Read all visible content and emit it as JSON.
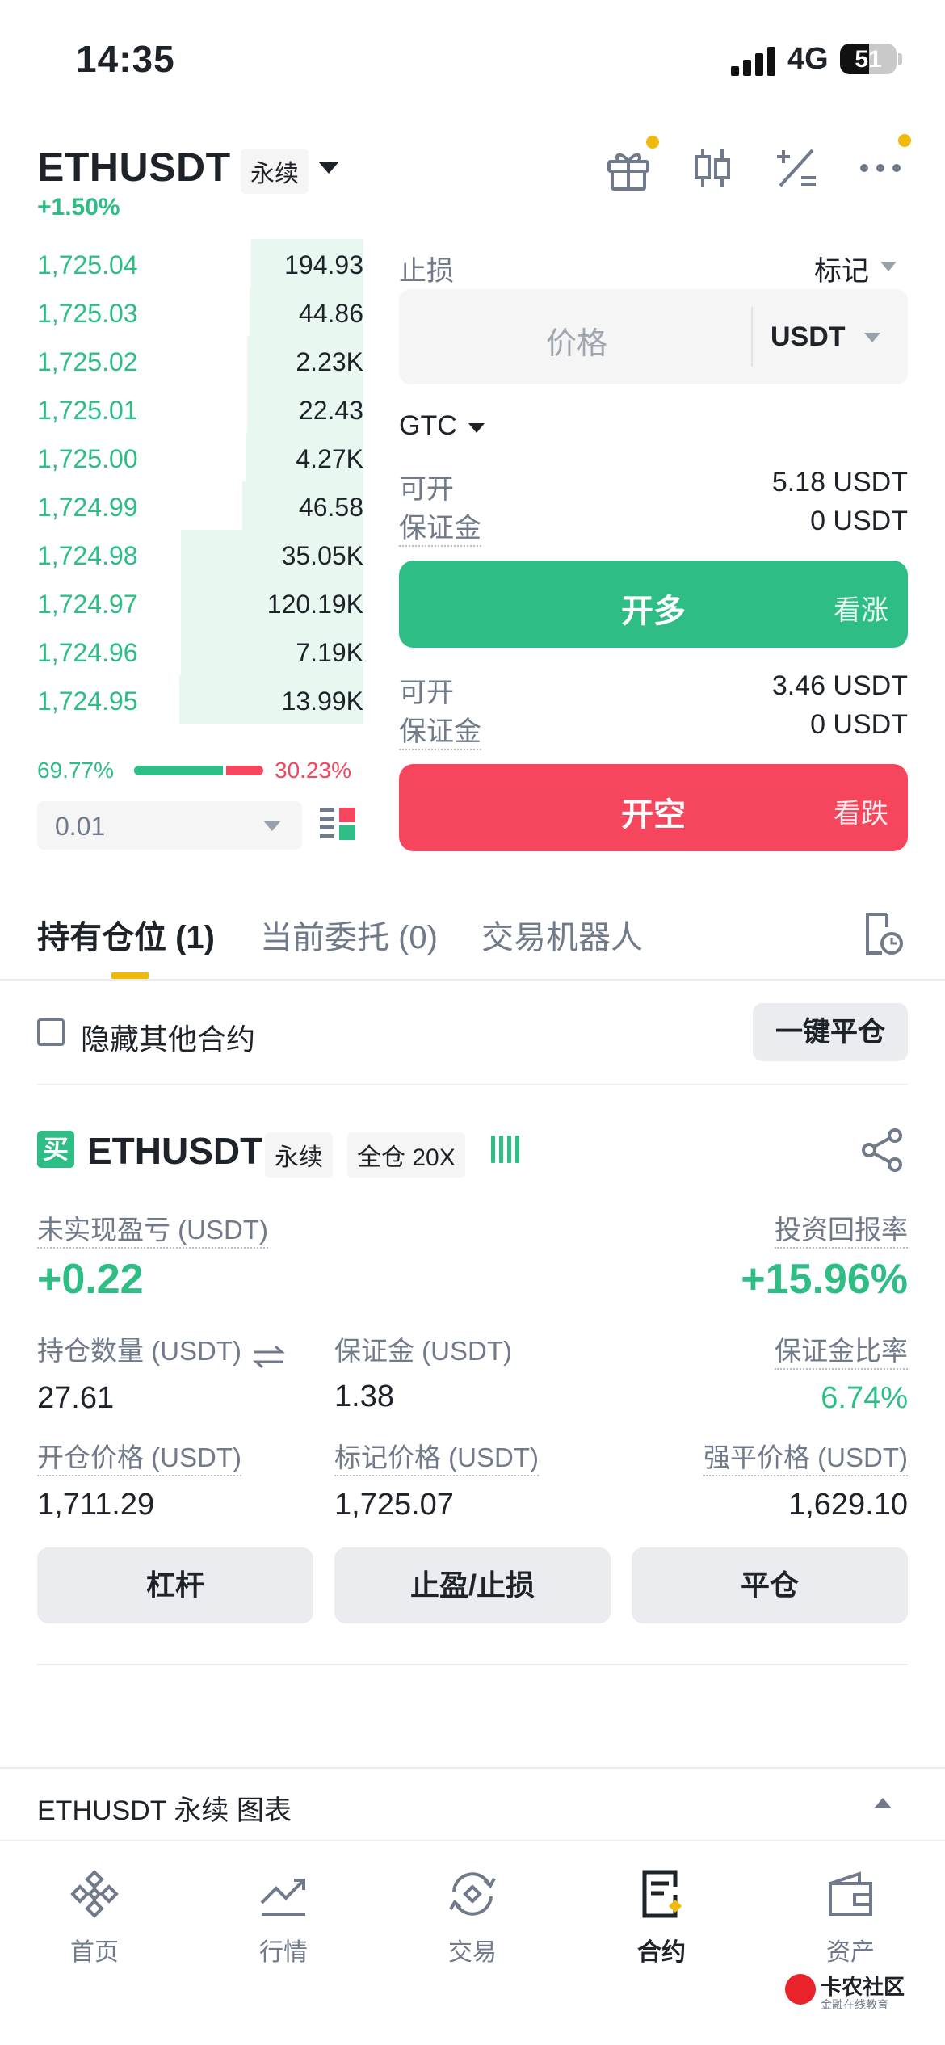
{
  "status_bar": {
    "time": "14:35",
    "network": "4G",
    "battery": "51",
    "battery_level": 0.51
  },
  "header": {
    "symbol": "ETHUSDT",
    "type_tag": "永续",
    "change": "+1.50%",
    "icons": [
      "gift-icon",
      "candlestick-icon",
      "calculator-icon",
      "more-icon"
    ]
  },
  "orderbook": {
    "rows": [
      {
        "price": "1,725.04",
        "qty": "194.93",
        "depth": 0.61
      },
      {
        "price": "1,725.03",
        "qty": "44.86",
        "depth": 0.62
      },
      {
        "price": "1,725.02",
        "qty": "2.23K",
        "depth": 0.63
      },
      {
        "price": "1,725.01",
        "qty": "22.43",
        "depth": 0.63
      },
      {
        "price": "1,725.00",
        "qty": "4.27K",
        "depth": 0.64
      },
      {
        "price": "1,724.99",
        "qty": "46.58",
        "depth": 0.66
      },
      {
        "price": "1,724.98",
        "qty": "35.05K",
        "depth": 0.99
      },
      {
        "price": "1,724.97",
        "qty": "120.19K",
        "depth": 0.99
      },
      {
        "price": "1,724.96",
        "qty": "7.19K",
        "depth": 0.99
      },
      {
        "price": "1,724.95",
        "qty": "13.99K",
        "depth": 1.0
      }
    ],
    "buy_ratio": "69.77%",
    "sell_ratio": "30.23%",
    "buy_ratio_value": 0.6977,
    "precision": "0.01"
  },
  "form": {
    "order_type": "止损",
    "trigger_type": "标记",
    "price_placeholder": "价格",
    "price_unit": "USDT",
    "time_in_force": "GTC",
    "long": {
      "avail_label": "可开",
      "avail_value": "5.18 USDT",
      "margin_label": "保证金",
      "margin_value": "0 USDT",
      "button": "开多",
      "button_sub": "看涨"
    },
    "short": {
      "avail_label": "可开",
      "avail_value": "3.46 USDT",
      "margin_label": "保证金",
      "margin_value": "0 USDT",
      "button": "开空",
      "button_sub": "看跌"
    }
  },
  "tabs": [
    {
      "label": "持有仓位 (1)",
      "active": true
    },
    {
      "label": "当前委托 (0)",
      "active": false
    },
    {
      "label": "交易机器人",
      "active": false
    }
  ],
  "hide_others_label": "隐藏其他合约",
  "close_all_label": "一键平仓",
  "position": {
    "side": "买",
    "symbol": "ETHUSDT",
    "tag1": "永续",
    "tag2": "全仓 20X",
    "pnl_label": "未实现盈亏 (USDT)",
    "pnl_value": "+0.22",
    "roe_label": "投资回报率",
    "roe_value": "+15.96%",
    "size_label": "持仓数量 (USDT)",
    "size_value": "27.61",
    "margin_label": "保证金 (USDT)",
    "margin_value": "1.38",
    "margin_ratio_label": "保证金比率",
    "margin_ratio_value": "6.74%",
    "entry_label": "开仓价格 (USDT)",
    "entry_value": "1,711.29",
    "mark_label": "标记价格 (USDT)",
    "mark_value": "1,725.07",
    "liq_label": "强平价格 (USDT)",
    "liq_value": "1,629.10",
    "actions": [
      "杠杆",
      "止盈/止损",
      "平仓"
    ]
  },
  "chart_bar": {
    "label": "ETHUSDT 永续  图表"
  },
  "nav": [
    {
      "label": "首页",
      "icon": "home-icon"
    },
    {
      "label": "行情",
      "icon": "markets-icon"
    },
    {
      "label": "交易",
      "icon": "trade-icon"
    },
    {
      "label": "合约",
      "icon": "futures-icon",
      "active": true
    },
    {
      "label": "资产",
      "icon": "wallet-icon"
    }
  ],
  "watermark": {
    "title": "卡农社区",
    "subtitle": "金融在线教育"
  },
  "colors": {
    "green": "#2ebd85",
    "red": "#f6465d",
    "yellow": "#f0b90b"
  }
}
